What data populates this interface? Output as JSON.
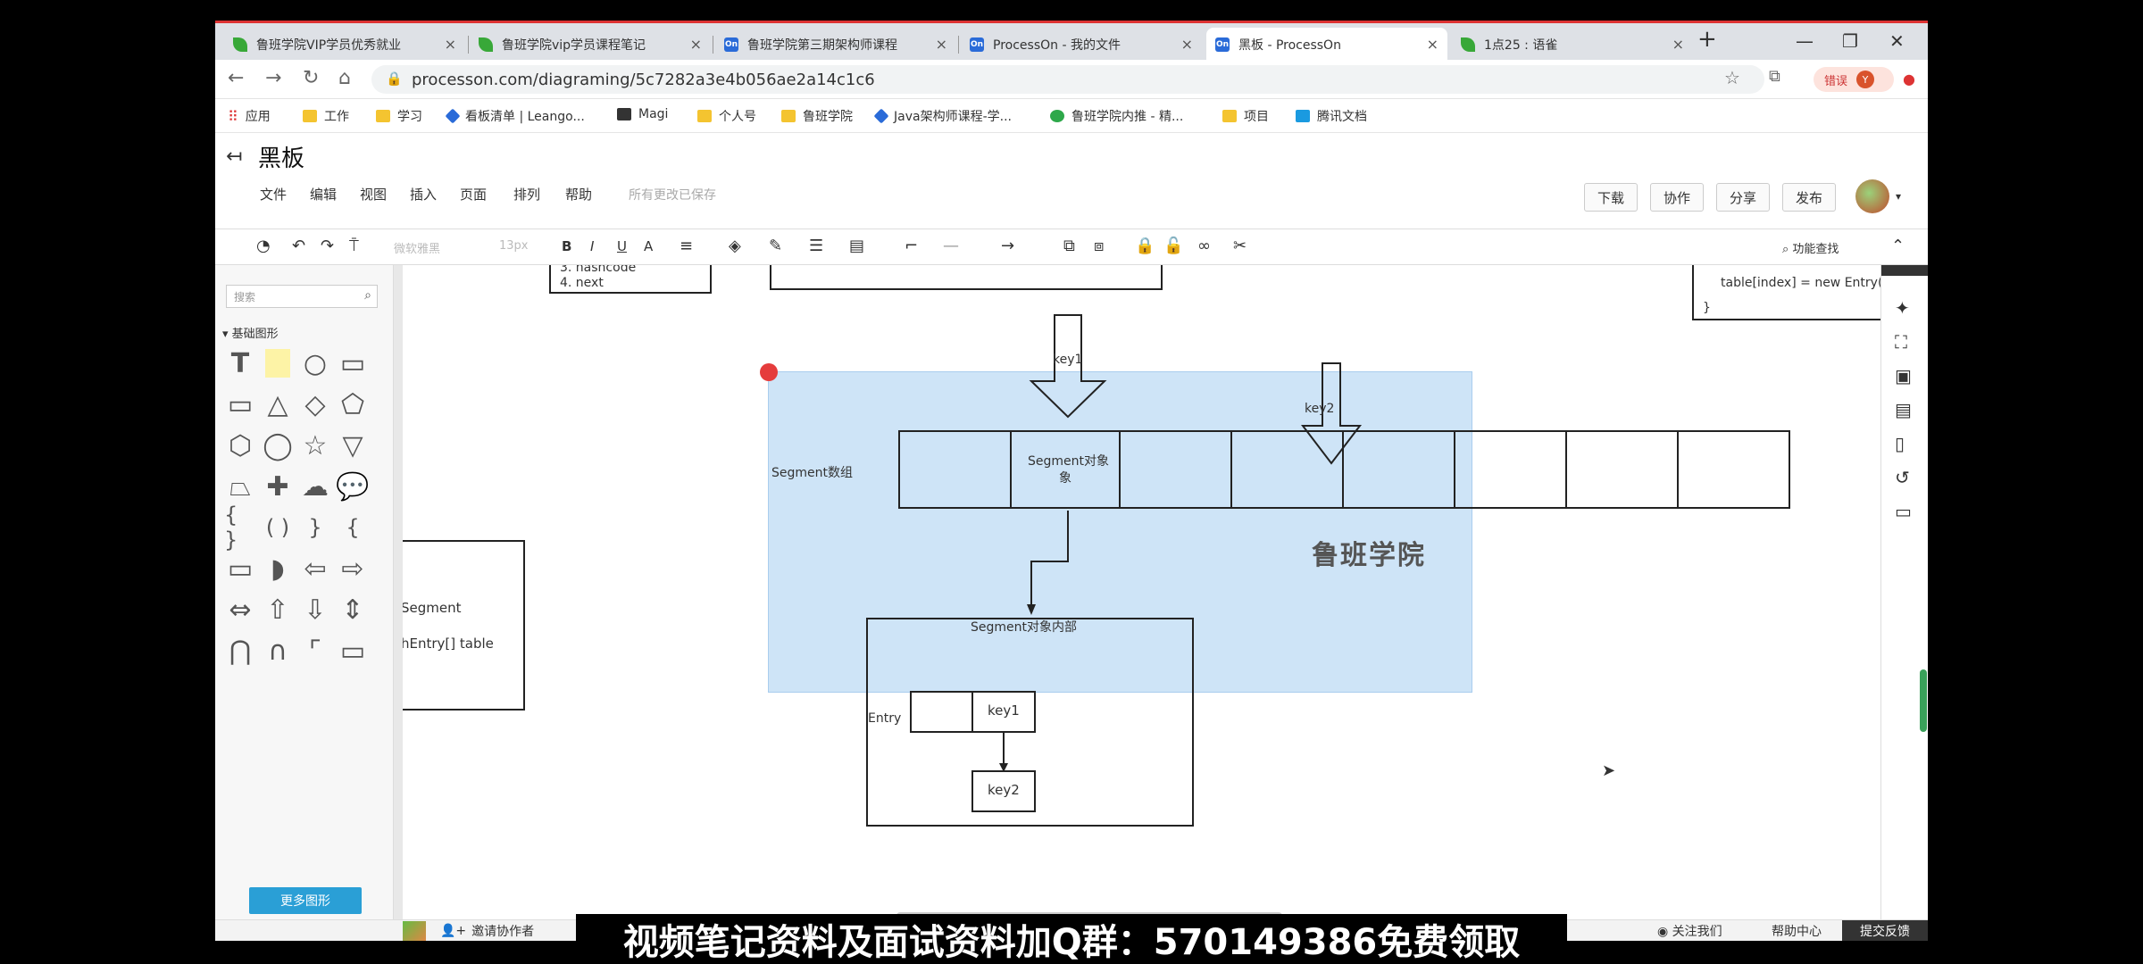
{
  "browser": {
    "tabs": [
      {
        "label": "鲁班学院VIP学员优秀就业",
        "icon": "leaf"
      },
      {
        "label": "鲁班学院vip学员课程笔记",
        "icon": "leaf"
      },
      {
        "label": "鲁班学院第三期架构师课程",
        "icon": "on"
      },
      {
        "label": "ProcessOn - 我的文件",
        "icon": "on"
      },
      {
        "label": "黑板 - ProcessOn",
        "icon": "on"
      },
      {
        "label": "1点25 : 语雀",
        "icon": "leaf"
      }
    ],
    "tab_close": "×",
    "new_tab": "+",
    "url": "processon.com/diagraming/5c7282a3e4b056ae2a14c1c6",
    "sync_label": "错误",
    "avatar_letter": "Y",
    "bookmarks": [
      "应用",
      "工作",
      "学习",
      "看板清单 | Leango...",
      "Magi",
      "个人号",
      "鲁班学院",
      "Java架构师课程-学...",
      "鲁班学院内推 - 精...",
      "项目",
      "腾讯文档"
    ]
  },
  "app": {
    "title": "黑板",
    "menus": [
      "文件",
      "编辑",
      "视图",
      "插入",
      "页面",
      "排列",
      "帮助"
    ],
    "save_status": "所有更改已保存",
    "header_buttons": [
      "下载",
      "协作",
      "分享",
      "发布"
    ],
    "toolbar": {
      "font": "微软雅黑",
      "size": "13px",
      "find": "功能查找"
    }
  },
  "left_panel": {
    "search_placeholder": "搜索",
    "section_title": "基础图形",
    "more_shapes": "更多图形"
  },
  "diagram": {
    "top_left_lines": [
      "3. hashcode",
      "4. next"
    ],
    "top_right_code": "table[index]  = new Entry(key,value)",
    "top_right_brace": "}",
    "key1": "key1",
    "key2": "key2",
    "segment_array_label": "Segment数组",
    "segment_object_label": "Segment对象",
    "left_box_lines": [
      "Segment",
      "hEntry[] table"
    ],
    "inner_box_label": "Segment对象内部",
    "entry_label": "Entry",
    "entry_key1": "key1",
    "entry_key2": "key2",
    "watermark": "鲁班学院"
  },
  "bottom_bar": {
    "invite": "邀请协作者",
    "follow": "关注我们",
    "help": "帮助中心",
    "feedback": "提交反馈"
  },
  "subtitle": "视频笔记资料及面试资料加Q群：570149386免费领取"
}
